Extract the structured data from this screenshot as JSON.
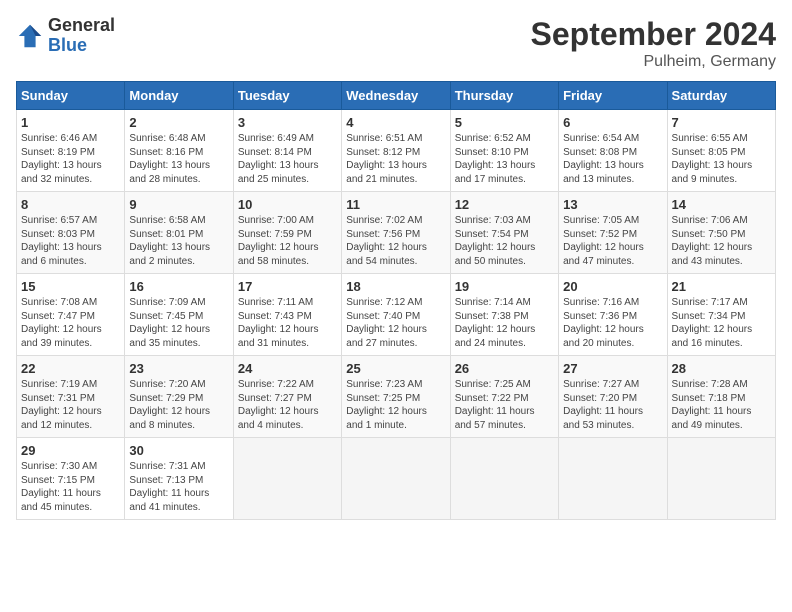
{
  "logo": {
    "general": "General",
    "blue": "Blue"
  },
  "header": {
    "month": "September 2024",
    "location": "Pulheim, Germany"
  },
  "weekdays": [
    "Sunday",
    "Monday",
    "Tuesday",
    "Wednesday",
    "Thursday",
    "Friday",
    "Saturday"
  ],
  "weeks": [
    [
      {
        "day": "1",
        "info": "Sunrise: 6:46 AM\nSunset: 8:19 PM\nDaylight: 13 hours\nand 32 minutes."
      },
      {
        "day": "2",
        "info": "Sunrise: 6:48 AM\nSunset: 8:16 PM\nDaylight: 13 hours\nand 28 minutes."
      },
      {
        "day": "3",
        "info": "Sunrise: 6:49 AM\nSunset: 8:14 PM\nDaylight: 13 hours\nand 25 minutes."
      },
      {
        "day": "4",
        "info": "Sunrise: 6:51 AM\nSunset: 8:12 PM\nDaylight: 13 hours\nand 21 minutes."
      },
      {
        "day": "5",
        "info": "Sunrise: 6:52 AM\nSunset: 8:10 PM\nDaylight: 13 hours\nand 17 minutes."
      },
      {
        "day": "6",
        "info": "Sunrise: 6:54 AM\nSunset: 8:08 PM\nDaylight: 13 hours\nand 13 minutes."
      },
      {
        "day": "7",
        "info": "Sunrise: 6:55 AM\nSunset: 8:05 PM\nDaylight: 13 hours\nand 9 minutes."
      }
    ],
    [
      {
        "day": "8",
        "info": "Sunrise: 6:57 AM\nSunset: 8:03 PM\nDaylight: 13 hours\nand 6 minutes."
      },
      {
        "day": "9",
        "info": "Sunrise: 6:58 AM\nSunset: 8:01 PM\nDaylight: 13 hours\nand 2 minutes."
      },
      {
        "day": "10",
        "info": "Sunrise: 7:00 AM\nSunset: 7:59 PM\nDaylight: 12 hours\nand 58 minutes."
      },
      {
        "day": "11",
        "info": "Sunrise: 7:02 AM\nSunset: 7:56 PM\nDaylight: 12 hours\nand 54 minutes."
      },
      {
        "day": "12",
        "info": "Sunrise: 7:03 AM\nSunset: 7:54 PM\nDaylight: 12 hours\nand 50 minutes."
      },
      {
        "day": "13",
        "info": "Sunrise: 7:05 AM\nSunset: 7:52 PM\nDaylight: 12 hours\nand 47 minutes."
      },
      {
        "day": "14",
        "info": "Sunrise: 7:06 AM\nSunset: 7:50 PM\nDaylight: 12 hours\nand 43 minutes."
      }
    ],
    [
      {
        "day": "15",
        "info": "Sunrise: 7:08 AM\nSunset: 7:47 PM\nDaylight: 12 hours\nand 39 minutes."
      },
      {
        "day": "16",
        "info": "Sunrise: 7:09 AM\nSunset: 7:45 PM\nDaylight: 12 hours\nand 35 minutes."
      },
      {
        "day": "17",
        "info": "Sunrise: 7:11 AM\nSunset: 7:43 PM\nDaylight: 12 hours\nand 31 minutes."
      },
      {
        "day": "18",
        "info": "Sunrise: 7:12 AM\nSunset: 7:40 PM\nDaylight: 12 hours\nand 27 minutes."
      },
      {
        "day": "19",
        "info": "Sunrise: 7:14 AM\nSunset: 7:38 PM\nDaylight: 12 hours\nand 24 minutes."
      },
      {
        "day": "20",
        "info": "Sunrise: 7:16 AM\nSunset: 7:36 PM\nDaylight: 12 hours\nand 20 minutes."
      },
      {
        "day": "21",
        "info": "Sunrise: 7:17 AM\nSunset: 7:34 PM\nDaylight: 12 hours\nand 16 minutes."
      }
    ],
    [
      {
        "day": "22",
        "info": "Sunrise: 7:19 AM\nSunset: 7:31 PM\nDaylight: 12 hours\nand 12 minutes."
      },
      {
        "day": "23",
        "info": "Sunrise: 7:20 AM\nSunset: 7:29 PM\nDaylight: 12 hours\nand 8 minutes."
      },
      {
        "day": "24",
        "info": "Sunrise: 7:22 AM\nSunset: 7:27 PM\nDaylight: 12 hours\nand 4 minutes."
      },
      {
        "day": "25",
        "info": "Sunrise: 7:23 AM\nSunset: 7:25 PM\nDaylight: 12 hours\nand 1 minute."
      },
      {
        "day": "26",
        "info": "Sunrise: 7:25 AM\nSunset: 7:22 PM\nDaylight: 11 hours\nand 57 minutes."
      },
      {
        "day": "27",
        "info": "Sunrise: 7:27 AM\nSunset: 7:20 PM\nDaylight: 11 hours\nand 53 minutes."
      },
      {
        "day": "28",
        "info": "Sunrise: 7:28 AM\nSunset: 7:18 PM\nDaylight: 11 hours\nand 49 minutes."
      }
    ],
    [
      {
        "day": "29",
        "info": "Sunrise: 7:30 AM\nSunset: 7:15 PM\nDaylight: 11 hours\nand 45 minutes."
      },
      {
        "day": "30",
        "info": "Sunrise: 7:31 AM\nSunset: 7:13 PM\nDaylight: 11 hours\nand 41 minutes."
      },
      {
        "day": "",
        "info": ""
      },
      {
        "day": "",
        "info": ""
      },
      {
        "day": "",
        "info": ""
      },
      {
        "day": "",
        "info": ""
      },
      {
        "day": "",
        "info": ""
      }
    ]
  ]
}
